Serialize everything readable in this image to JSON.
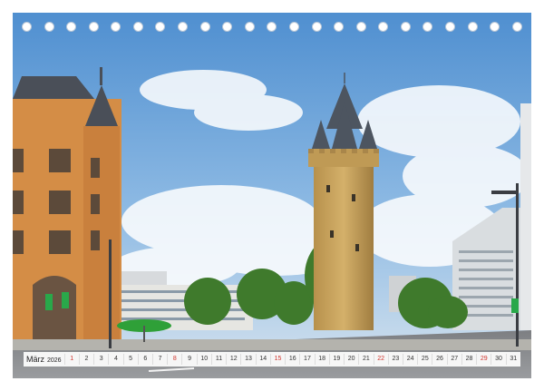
{
  "calendar": {
    "month": "März",
    "year": "2026",
    "days": [
      {
        "n": "1",
        "sunday": true
      },
      {
        "n": "2",
        "sunday": false
      },
      {
        "n": "3",
        "sunday": false
      },
      {
        "n": "4",
        "sunday": false
      },
      {
        "n": "5",
        "sunday": false
      },
      {
        "n": "6",
        "sunday": false
      },
      {
        "n": "7",
        "sunday": false
      },
      {
        "n": "8",
        "sunday": true
      },
      {
        "n": "9",
        "sunday": false
      },
      {
        "n": "10",
        "sunday": false
      },
      {
        "n": "11",
        "sunday": false
      },
      {
        "n": "12",
        "sunday": false
      },
      {
        "n": "13",
        "sunday": false
      },
      {
        "n": "14",
        "sunday": false
      },
      {
        "n": "15",
        "sunday": true
      },
      {
        "n": "16",
        "sunday": false
      },
      {
        "n": "17",
        "sunday": false
      },
      {
        "n": "18",
        "sunday": false
      },
      {
        "n": "19",
        "sunday": false
      },
      {
        "n": "20",
        "sunday": false
      },
      {
        "n": "21",
        "sunday": false
      },
      {
        "n": "22",
        "sunday": true
      },
      {
        "n": "23",
        "sunday": false
      },
      {
        "n": "24",
        "sunday": false
      },
      {
        "n": "25",
        "sunday": false
      },
      {
        "n": "26",
        "sunday": false
      },
      {
        "n": "27",
        "sunday": false
      },
      {
        "n": "28",
        "sunday": false
      },
      {
        "n": "29",
        "sunday": true
      },
      {
        "n": "30",
        "sunday": false
      },
      {
        "n": "31",
        "sunday": false
      }
    ],
    "spiral_hole_count": 23
  },
  "colors": {
    "sky": "#6aa6dc",
    "tower": "#c9a55e",
    "sunday": "#d0342c"
  }
}
